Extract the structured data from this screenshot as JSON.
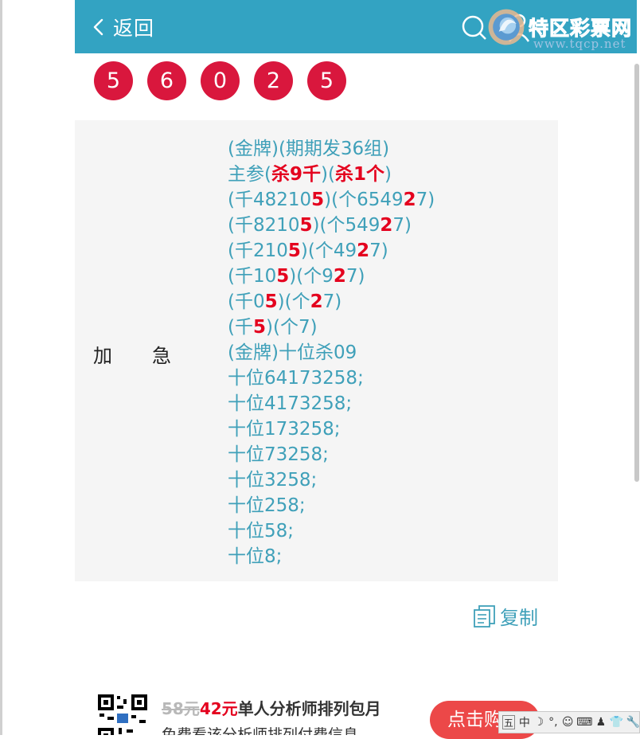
{
  "header": {
    "back_label": "返回",
    "watermark_title": "特区彩票网",
    "watermark_url": "www.tqcp.net",
    "bg_color": "#33a3c2"
  },
  "balls": [
    "5",
    "6",
    "0",
    "2",
    "5"
  ],
  "ball_color": "#d9173d",
  "panel": {
    "label_left": "加",
    "label_right": "急",
    "lines": [
      [
        {
          "t": "(金牌)(期期发36组)"
        }
      ],
      [
        {
          "t": "主参("
        },
        {
          "t": "杀9千",
          "hl": true
        },
        {
          "t": ")("
        },
        {
          "t": "杀1个",
          "hl": true
        },
        {
          "t": ")"
        }
      ],
      [
        {
          "t": "(千48210"
        },
        {
          "t": "5",
          "hl": true
        },
        {
          "t": ")(个6549"
        },
        {
          "t": "2",
          "hl": true
        },
        {
          "t": "7)"
        }
      ],
      [
        {
          "t": "(千8210"
        },
        {
          "t": "5",
          "hl": true
        },
        {
          "t": ")(个549"
        },
        {
          "t": "2",
          "hl": true
        },
        {
          "t": "7)"
        }
      ],
      [
        {
          "t": "(千210"
        },
        {
          "t": "5",
          "hl": true
        },
        {
          "t": ")(个49"
        },
        {
          "t": "2",
          "hl": true
        },
        {
          "t": "7)"
        }
      ],
      [
        {
          "t": "(千10"
        },
        {
          "t": "5",
          "hl": true
        },
        {
          "t": ")(个9"
        },
        {
          "t": "2",
          "hl": true
        },
        {
          "t": "7)"
        }
      ],
      [
        {
          "t": "(千0"
        },
        {
          "t": "5",
          "hl": true
        },
        {
          "t": ")(个"
        },
        {
          "t": "2",
          "hl": true
        },
        {
          "t": "7)"
        }
      ],
      [
        {
          "t": "(千"
        },
        {
          "t": "5",
          "hl": true
        },
        {
          "t": ")(个7)"
        }
      ],
      [
        {
          "t": "(金牌)十位杀09"
        }
      ],
      [
        {
          "t": "十位64173258;"
        }
      ],
      [
        {
          "t": "十位4173258;"
        }
      ],
      [
        {
          "t": "十位173258;"
        }
      ],
      [
        {
          "t": "十位73258;"
        }
      ],
      [
        {
          "t": "十位3258;"
        }
      ],
      [
        {
          "t": "十位258;"
        }
      ],
      [
        {
          "t": "十位58;"
        }
      ],
      [
        {
          "t": "十位8;"
        }
      ]
    ],
    "text_color": "#3fa0b9",
    "highlight_color": "#e4001e"
  },
  "copy_label": "复制",
  "promo": {
    "price_old": "58元",
    "price_new": "42元",
    "title_rest": "单人分析师排列包月",
    "subtitle": "免费看该分析师排列付费信息",
    "cta_label": "点击购买"
  },
  "ime": {
    "items": [
      "五",
      "中",
      "☽",
      "°,",
      "☺",
      "⌨",
      "♟",
      "👕",
      "🔧"
    ]
  }
}
